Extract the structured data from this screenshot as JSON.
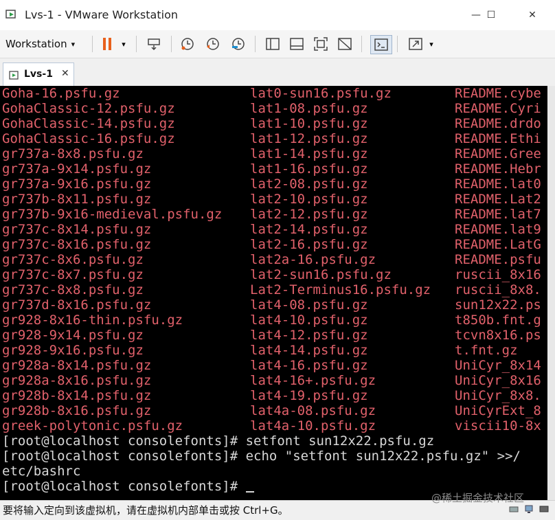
{
  "window": {
    "title": "Lvs-1 - VMware Workstation",
    "minimize_glyph": "—",
    "maximize_glyph": "☐",
    "close_glyph": "✕"
  },
  "toolbar": {
    "workstation_label": "Workstation",
    "caret": "▾",
    "accent_color": "#e8601c",
    "icons": [
      "pause-icon",
      "send-keys-icon",
      "snapshot-icon",
      "revert-snapshot-icon",
      "snapshot-manager-icon",
      "sidebar-view-icon",
      "console-view-icon",
      "fullscreen-icon",
      "unity-icon",
      "terminal-icon",
      "stretch-icon"
    ]
  },
  "tab": {
    "label": "Lvs-1",
    "close_glyph": "✕"
  },
  "console": {
    "text_color": "#e2616b",
    "rows": [
      [
        "Goha-16.psfu.gz",
        "lat0-sun16.psfu.gz",
        "README.cybe"
      ],
      [
        "GohaClassic-12.psfu.gz",
        "lat1-08.psfu.gz",
        "README.Cyri"
      ],
      [
        "GohaClassic-14.psfu.gz",
        "lat1-10.psfu.gz",
        "README.drdo"
      ],
      [
        "GohaClassic-16.psfu.gz",
        "lat1-12.psfu.gz",
        "README.Ethi"
      ],
      [
        "gr737a-8x8.psfu.gz",
        "lat1-14.psfu.gz",
        "README.Gree"
      ],
      [
        "gr737a-9x14.psfu.gz",
        "lat1-16.psfu.gz",
        "README.Hebr"
      ],
      [
        "gr737a-9x16.psfu.gz",
        "lat2-08.psfu.gz",
        "README.lat0"
      ],
      [
        "gr737b-8x11.psfu.gz",
        "lat2-10.psfu.gz",
        "README.Lat2"
      ],
      [
        "gr737b-9x16-medieval.psfu.gz",
        "lat2-12.psfu.gz",
        "README.lat7"
      ],
      [
        "gr737c-8x14.psfu.gz",
        "lat2-14.psfu.gz",
        "README.lat9"
      ],
      [
        "gr737c-8x16.psfu.gz",
        "lat2-16.psfu.gz",
        "README.LatG"
      ],
      [
        "gr737c-8x6.psfu.gz",
        "lat2a-16.psfu.gz",
        "README.psfu"
      ],
      [
        "gr737c-8x7.psfu.gz",
        "lat2-sun16.psfu.gz",
        "ruscii_8x16"
      ],
      [
        "gr737c-8x8.psfu.gz",
        "Lat2-Terminus16.psfu.gz",
        "ruscii_8x8."
      ],
      [
        "gr737d-8x16.psfu.gz",
        "lat4-08.psfu.gz",
        "sun12x22.ps"
      ],
      [
        "gr928-8x16-thin.psfu.gz",
        "lat4-10.psfu.gz",
        "t850b.fnt.g"
      ],
      [
        "gr928-9x14.psfu.gz",
        "lat4-12.psfu.gz",
        "tcvn8x16.ps"
      ],
      [
        "gr928-9x16.psfu.gz",
        "lat4-14.psfu.gz",
        "t.fnt.gz"
      ],
      [
        "gr928a-8x14.psfu.gz",
        "lat4-16.psfu.gz",
        "UniCyr_8x14"
      ],
      [
        "gr928a-8x16.psfu.gz",
        "lat4-16+.psfu.gz",
        "UniCyr_8x16"
      ],
      [
        "gr928b-8x14.psfu.gz",
        "lat4-19.psfu.gz",
        "UniCyr_8x8."
      ],
      [
        "gr928b-8x16.psfu.gz",
        "lat4a-08.psfu.gz",
        "UniCyrExt_8"
      ],
      [
        "greek-polytonic.psfu.gz",
        "lat4a-10.psfu.gz",
        "viscii10-8x"
      ]
    ],
    "command_lines": [
      "[root@localhost consolefonts]# setfont sun12x22.psfu.gz",
      "[root@localhost consolefonts]# echo \"setfont sun12x22.psfu.gz\" >>/",
      "etc/bashrc",
      "[root@localhost consolefonts]# "
    ]
  },
  "status": {
    "text": "要将输入定向到该虚拟机，请在虚拟机内部单击或按 Ctrl+G。"
  },
  "watermark": "@稀土掘金技术社区"
}
